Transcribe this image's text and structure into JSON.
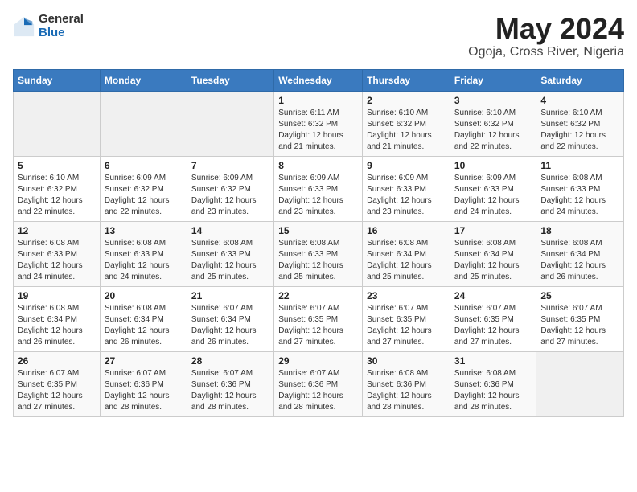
{
  "logo": {
    "general": "General",
    "blue": "Blue"
  },
  "header": {
    "month_year": "May 2024",
    "location": "Ogoja, Cross River, Nigeria"
  },
  "weekdays": [
    "Sunday",
    "Monday",
    "Tuesday",
    "Wednesday",
    "Thursday",
    "Friday",
    "Saturday"
  ],
  "weeks": [
    [
      {
        "num": "",
        "detail": ""
      },
      {
        "num": "",
        "detail": ""
      },
      {
        "num": "",
        "detail": ""
      },
      {
        "num": "1",
        "detail": "Sunrise: 6:11 AM\nSunset: 6:32 PM\nDaylight: 12 hours\nand 21 minutes."
      },
      {
        "num": "2",
        "detail": "Sunrise: 6:10 AM\nSunset: 6:32 PM\nDaylight: 12 hours\nand 21 minutes."
      },
      {
        "num": "3",
        "detail": "Sunrise: 6:10 AM\nSunset: 6:32 PM\nDaylight: 12 hours\nand 22 minutes."
      },
      {
        "num": "4",
        "detail": "Sunrise: 6:10 AM\nSunset: 6:32 PM\nDaylight: 12 hours\nand 22 minutes."
      }
    ],
    [
      {
        "num": "5",
        "detail": "Sunrise: 6:10 AM\nSunset: 6:32 PM\nDaylight: 12 hours\nand 22 minutes."
      },
      {
        "num": "6",
        "detail": "Sunrise: 6:09 AM\nSunset: 6:32 PM\nDaylight: 12 hours\nand 22 minutes."
      },
      {
        "num": "7",
        "detail": "Sunrise: 6:09 AM\nSunset: 6:32 PM\nDaylight: 12 hours\nand 23 minutes."
      },
      {
        "num": "8",
        "detail": "Sunrise: 6:09 AM\nSunset: 6:33 PM\nDaylight: 12 hours\nand 23 minutes."
      },
      {
        "num": "9",
        "detail": "Sunrise: 6:09 AM\nSunset: 6:33 PM\nDaylight: 12 hours\nand 23 minutes."
      },
      {
        "num": "10",
        "detail": "Sunrise: 6:09 AM\nSunset: 6:33 PM\nDaylight: 12 hours\nand 24 minutes."
      },
      {
        "num": "11",
        "detail": "Sunrise: 6:08 AM\nSunset: 6:33 PM\nDaylight: 12 hours\nand 24 minutes."
      }
    ],
    [
      {
        "num": "12",
        "detail": "Sunrise: 6:08 AM\nSunset: 6:33 PM\nDaylight: 12 hours\nand 24 minutes."
      },
      {
        "num": "13",
        "detail": "Sunrise: 6:08 AM\nSunset: 6:33 PM\nDaylight: 12 hours\nand 24 minutes."
      },
      {
        "num": "14",
        "detail": "Sunrise: 6:08 AM\nSunset: 6:33 PM\nDaylight: 12 hours\nand 25 minutes."
      },
      {
        "num": "15",
        "detail": "Sunrise: 6:08 AM\nSunset: 6:33 PM\nDaylight: 12 hours\nand 25 minutes."
      },
      {
        "num": "16",
        "detail": "Sunrise: 6:08 AM\nSunset: 6:34 PM\nDaylight: 12 hours\nand 25 minutes."
      },
      {
        "num": "17",
        "detail": "Sunrise: 6:08 AM\nSunset: 6:34 PM\nDaylight: 12 hours\nand 25 minutes."
      },
      {
        "num": "18",
        "detail": "Sunrise: 6:08 AM\nSunset: 6:34 PM\nDaylight: 12 hours\nand 26 minutes."
      }
    ],
    [
      {
        "num": "19",
        "detail": "Sunrise: 6:08 AM\nSunset: 6:34 PM\nDaylight: 12 hours\nand 26 minutes."
      },
      {
        "num": "20",
        "detail": "Sunrise: 6:08 AM\nSunset: 6:34 PM\nDaylight: 12 hours\nand 26 minutes."
      },
      {
        "num": "21",
        "detail": "Sunrise: 6:07 AM\nSunset: 6:34 PM\nDaylight: 12 hours\nand 26 minutes."
      },
      {
        "num": "22",
        "detail": "Sunrise: 6:07 AM\nSunset: 6:35 PM\nDaylight: 12 hours\nand 27 minutes."
      },
      {
        "num": "23",
        "detail": "Sunrise: 6:07 AM\nSunset: 6:35 PM\nDaylight: 12 hours\nand 27 minutes."
      },
      {
        "num": "24",
        "detail": "Sunrise: 6:07 AM\nSunset: 6:35 PM\nDaylight: 12 hours\nand 27 minutes."
      },
      {
        "num": "25",
        "detail": "Sunrise: 6:07 AM\nSunset: 6:35 PM\nDaylight: 12 hours\nand 27 minutes."
      }
    ],
    [
      {
        "num": "26",
        "detail": "Sunrise: 6:07 AM\nSunset: 6:35 PM\nDaylight: 12 hours\nand 27 minutes."
      },
      {
        "num": "27",
        "detail": "Sunrise: 6:07 AM\nSunset: 6:36 PM\nDaylight: 12 hours\nand 28 minutes."
      },
      {
        "num": "28",
        "detail": "Sunrise: 6:07 AM\nSunset: 6:36 PM\nDaylight: 12 hours\nand 28 minutes."
      },
      {
        "num": "29",
        "detail": "Sunrise: 6:07 AM\nSunset: 6:36 PM\nDaylight: 12 hours\nand 28 minutes."
      },
      {
        "num": "30",
        "detail": "Sunrise: 6:08 AM\nSunset: 6:36 PM\nDaylight: 12 hours\nand 28 minutes."
      },
      {
        "num": "31",
        "detail": "Sunrise: 6:08 AM\nSunset: 6:36 PM\nDaylight: 12 hours\nand 28 minutes."
      },
      {
        "num": "",
        "detail": ""
      }
    ]
  ]
}
